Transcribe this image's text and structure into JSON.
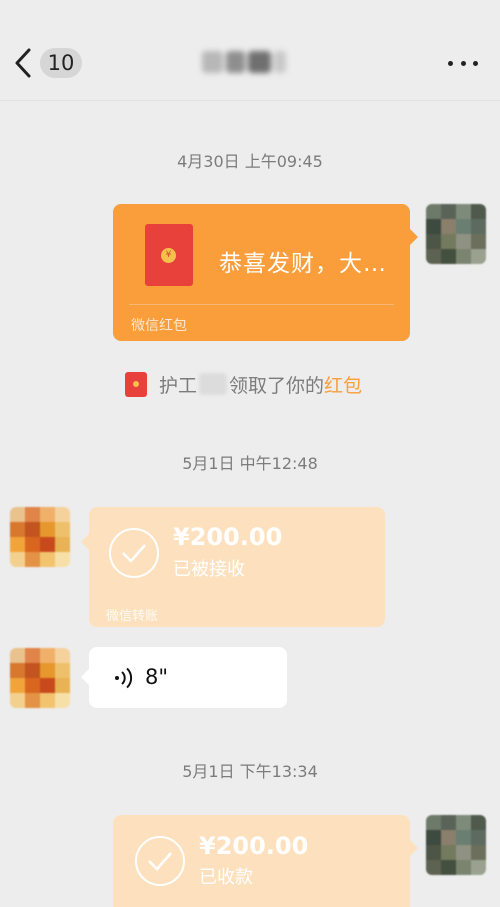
{
  "header": {
    "unread_count": "10"
  },
  "messages": {
    "ts1": "4月30日 上午09:45",
    "redpacket": {
      "text": "恭喜发财，大…",
      "footer": "微信红包",
      "coin": "¥"
    },
    "notice": {
      "prefix": "护工",
      "mid": "领取了你的",
      "link": "红包"
    },
    "ts2": "5月1日 中午12:48",
    "transfer1": {
      "amount": "¥200.00",
      "status": "已被接收",
      "footer": "微信转账"
    },
    "voice": {
      "duration": "8\""
    },
    "ts3": "5月1日 下午13:34",
    "transfer2": {
      "amount": "¥200.00",
      "status": "已收款"
    }
  },
  "colors": {
    "accent": "#fa9d3b",
    "transfer_bg": "#fde1be",
    "red": "#e8413b",
    "background": "#ededed"
  },
  "icons": [
    "back-icon",
    "more-icon",
    "red-packet-icon",
    "check-icon",
    "voice-icon"
  ]
}
